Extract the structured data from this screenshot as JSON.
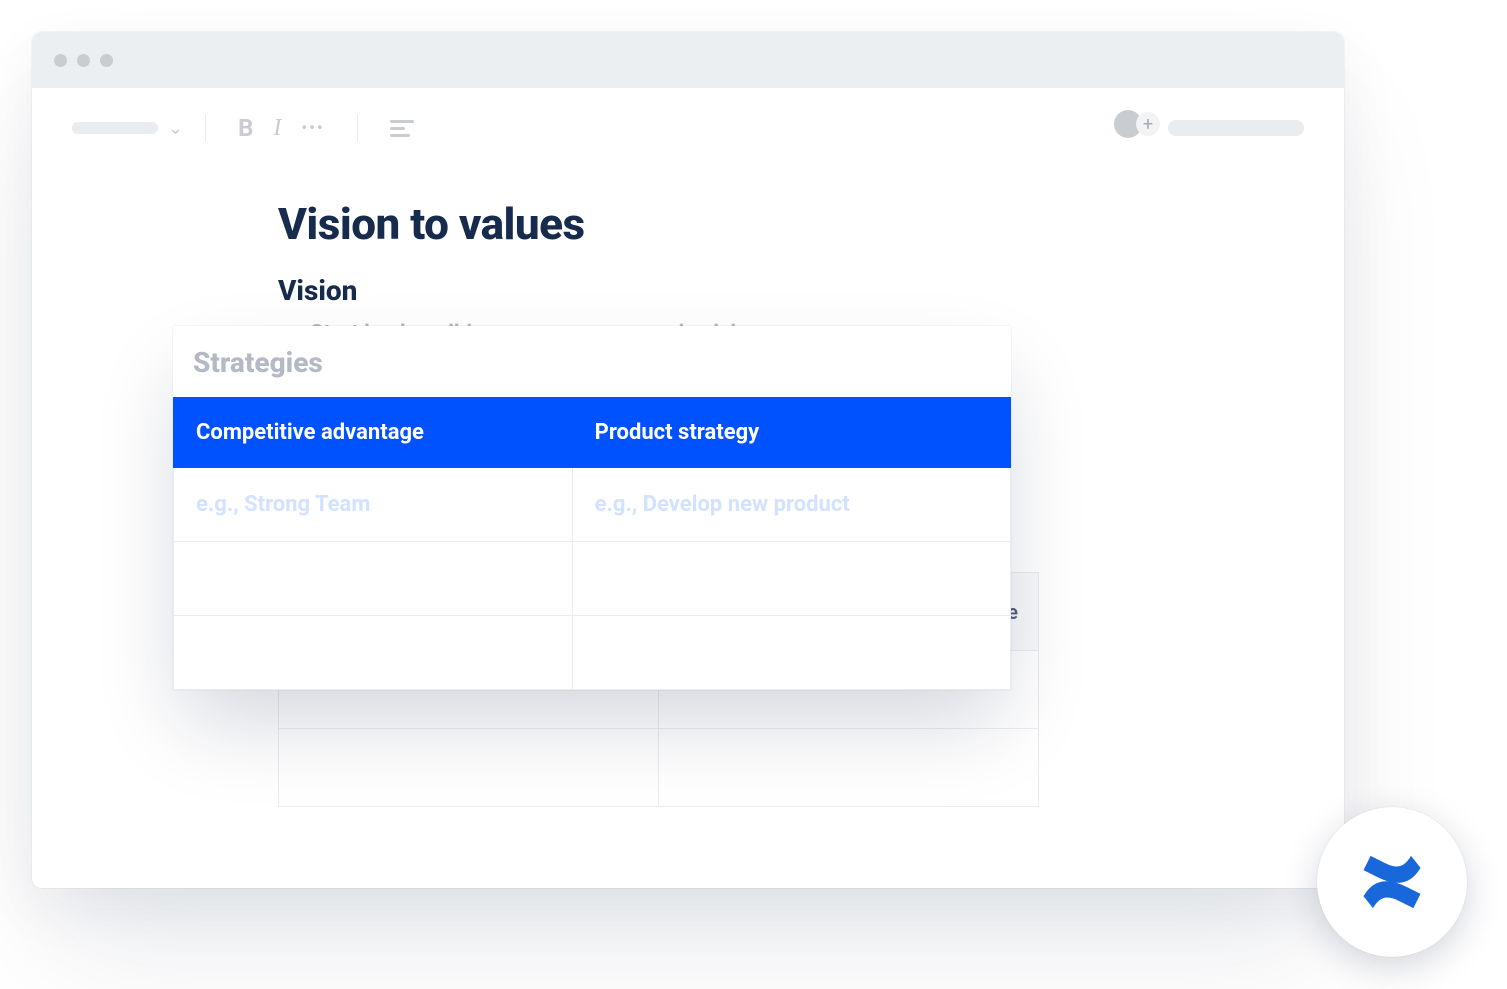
{
  "doc": {
    "title": "Vision to values",
    "section_vision_heading": "Vision",
    "vision_hint": "Start by describing your company main vision."
  },
  "bg_section": {
    "heading": "Strategies",
    "col2_header_fragment": "e"
  },
  "overlay": {
    "title": "Strategies",
    "columns": [
      "Competitive advantage",
      "Product strategy"
    ],
    "row1": [
      "e.g., Strong Team",
      "e.g., Develop new product"
    ]
  },
  "toolbar": {
    "bold": "B",
    "italic": "I",
    "more": "•••",
    "plus": "+"
  },
  "colors": {
    "accent": "#0052FF",
    "muted": "#B3BAC5",
    "text": "#172B4D"
  }
}
